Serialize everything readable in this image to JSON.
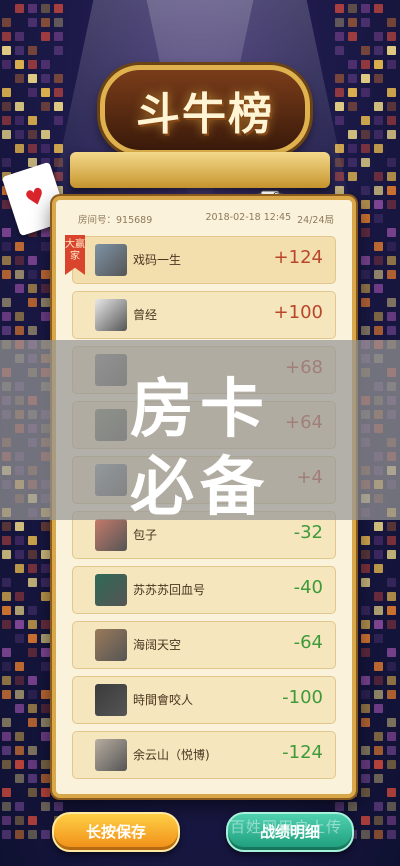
{
  "banner": {
    "title": "斗牛榜"
  },
  "room": {
    "label": "房间号：915689",
    "datetime": "2018-02-18 12:45",
    "count": "24/24局"
  },
  "winner_badge": "大赢家",
  "players": [
    {
      "name": "戏码一生",
      "score": "+124",
      "type": "pos",
      "avatar_color": "#7d93a6"
    },
    {
      "name": "曾经",
      "score": "+100",
      "type": "pos",
      "avatar_color": "#e8e8e8"
    },
    {
      "name": "",
      "score": "+68",
      "type": "pos",
      "avatar_color": "#8a8a8a"
    },
    {
      "name": "",
      "score": "+64",
      "type": "pos",
      "avatar_color": "#7c8a6c"
    },
    {
      "name": "",
      "score": "+4",
      "type": "pos",
      "avatar_color": "#8aa0b0"
    },
    {
      "name": "包子",
      "score": "-32",
      "type": "neg",
      "avatar_color": "#c47a6a"
    },
    {
      "name": "苏苏苏回血号",
      "score": "-40",
      "type": "neg",
      "avatar_color": "#2f6a55"
    },
    {
      "name": "海阔天空",
      "score": "-64",
      "type": "neg",
      "avatar_color": "#9a7a5a"
    },
    {
      "name": "時間會咬人",
      "score": "-100",
      "type": "neg",
      "avatar_color": "#3b3b3b"
    },
    {
      "name": "余云山（悦博)",
      "score": "-124",
      "type": "neg",
      "avatar_color": "#b8ada0"
    }
  ],
  "overlay": {
    "line1": "房卡",
    "line2": "必备"
  },
  "buttons": {
    "save": "长按保存",
    "detail": "战绩明细"
  },
  "watermark": "百姓网用户上传",
  "colors": {
    "positive": "#b8462b",
    "negative": "#3f9a3a",
    "panel": "#fbf2dc",
    "gold": "#d8a84a"
  }
}
